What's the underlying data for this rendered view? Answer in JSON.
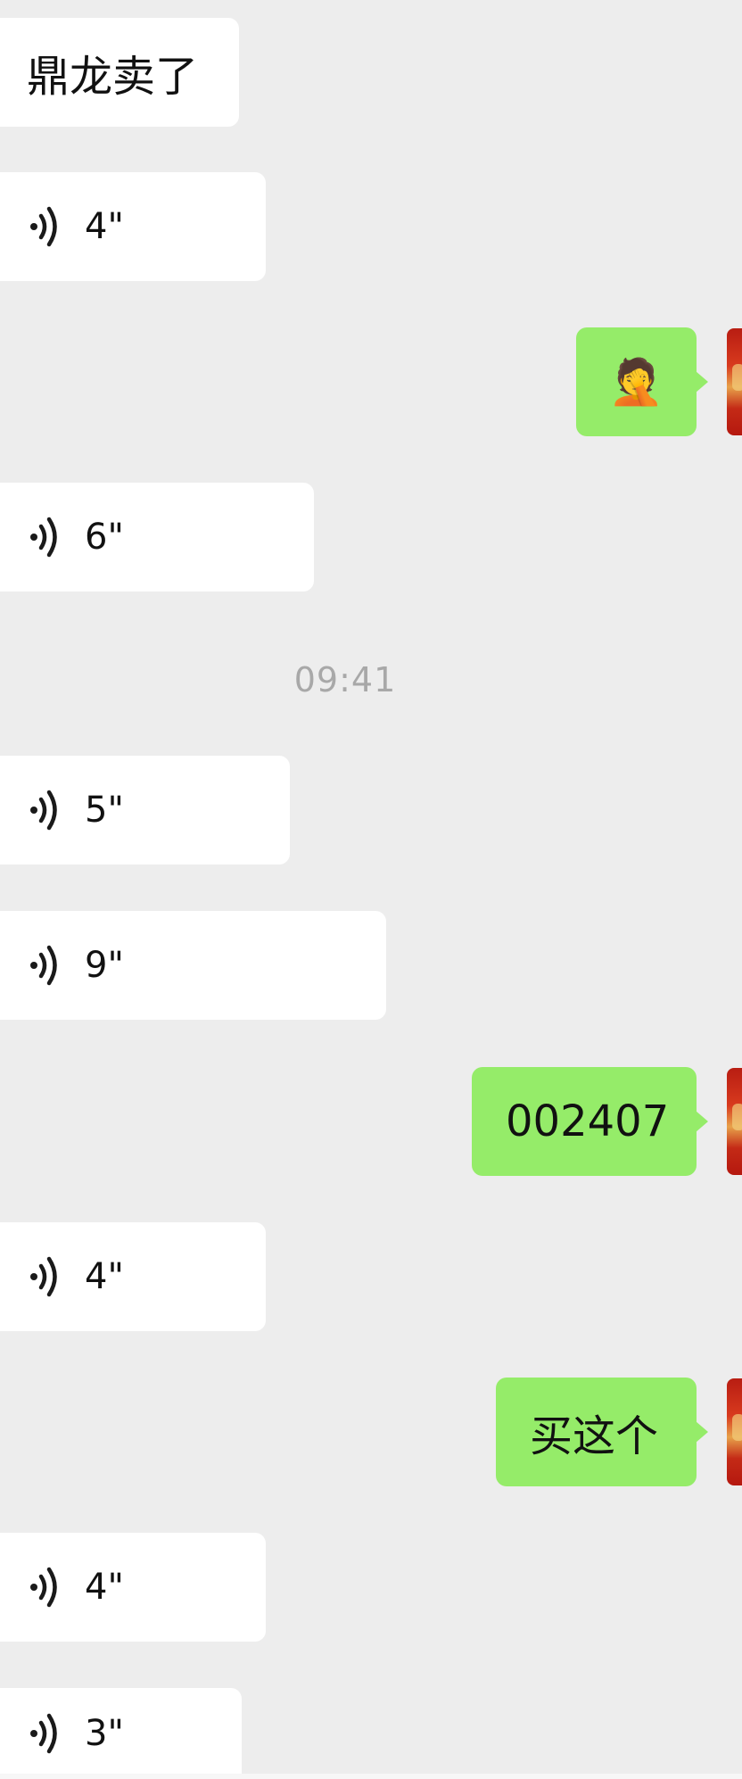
{
  "timestamp": "09:41",
  "messages": [
    {
      "side": "left",
      "type": "text",
      "text": "鼎龙卖了"
    },
    {
      "side": "left",
      "type": "voice",
      "duration": "4\""
    },
    {
      "side": "right",
      "type": "emoji",
      "emoji": "🤦"
    },
    {
      "side": "left",
      "type": "voice",
      "duration": "6\""
    },
    {
      "side": "left",
      "type": "voice",
      "duration": "5\""
    },
    {
      "side": "left",
      "type": "voice",
      "duration": "9\""
    },
    {
      "side": "right",
      "type": "text",
      "text": "002407"
    },
    {
      "side": "left",
      "type": "voice",
      "duration": "4\""
    },
    {
      "side": "right",
      "type": "text",
      "text": "买这个"
    },
    {
      "side": "left",
      "type": "voice",
      "duration": "4\""
    },
    {
      "side": "left",
      "type": "voice",
      "duration": "3\""
    }
  ],
  "icons": {
    "voice": "voice-wave-icon",
    "avatar": "user-avatar"
  },
  "colors": {
    "background": "#ededed",
    "bubble_left": "#ffffff",
    "bubble_right": "#95ec69",
    "timestamp": "#a8a8a8"
  }
}
